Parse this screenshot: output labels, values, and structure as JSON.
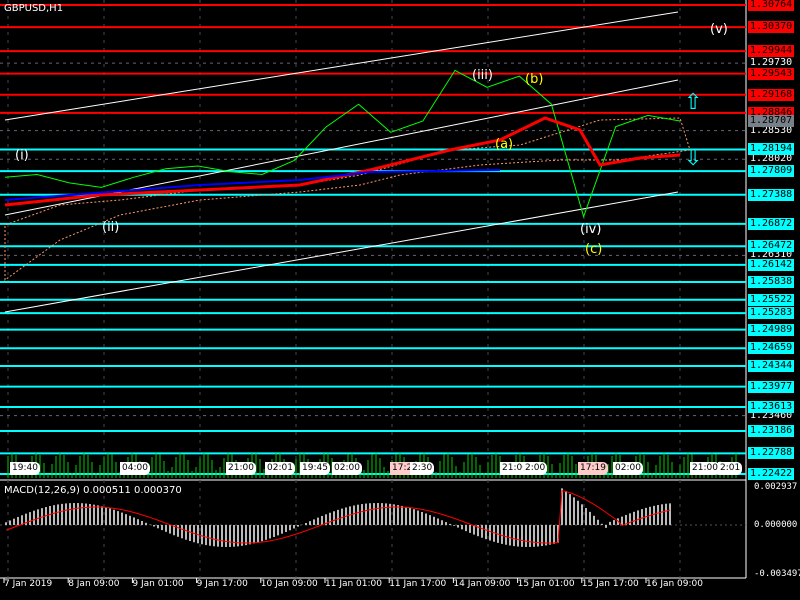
{
  "symbol_label": "GBPUSD,H1",
  "macd_label": "MACD(12,26,9) 0.000511 0.000370",
  "price_scale": {
    "max": 1.30764,
    "min": 1.22422
  },
  "red_levels": [
    "1.30764",
    "1.30370",
    "1.29944",
    "1.29543",
    "1.29168",
    "1.28846"
  ],
  "cyan_levels": [
    "1.28194",
    "1.27809",
    "1.27388",
    "1.26872",
    "1.26472",
    "1.26142",
    "1.25838",
    "1.25522",
    "1.25283",
    "1.24989",
    "1.24659",
    "1.24344",
    "1.23977",
    "1.23613",
    "1.23186",
    "1.22788",
    "1.22422"
  ],
  "white_levels": [
    "1.29730",
    "1.28530",
    "1.28020",
    "1.26310",
    "1.23460"
  ],
  "current_price": "1.28707",
  "macd_scale": {
    "max": "0.002937",
    "zero": "0.000000",
    "min": "-0.003497"
  },
  "time_labels": [
    "7 Jan 2019",
    "8 Jan 09:00",
    "9 Jan 01:00",
    "9 Jan 17:00",
    "10 Jan 09:00",
    "11 Jan 01:00",
    "11 Jan 17:00",
    "14 Jan 09:00",
    "15 Jan 01:00",
    "15 Jan 17:00",
    "16 Jan 09:00"
  ],
  "volume_tags": [
    "19:40",
    "04:00",
    "21:00",
    "02:01",
    "19:45",
    "02:00",
    "17:23",
    "2:30",
    "21:00",
    "2:00",
    "17:19",
    "02:00",
    "21:00",
    "2:01"
  ],
  "waves": [
    {
      "t": "(i)",
      "c": "#ffffff"
    },
    {
      "t": "(ii)",
      "c": "#ffffff"
    },
    {
      "t": "(iii)",
      "c": "#ffffff"
    },
    {
      "t": "(iv)",
      "c": "#ffffff"
    },
    {
      "t": "(v)",
      "c": "#ffffff"
    },
    {
      "t": "(a)",
      "c": "#ffff00"
    },
    {
      "t": "(b)",
      "c": "#ffff00"
    },
    {
      "t": "(c)",
      "c": "#ffff00"
    }
  ],
  "colors": {
    "red_level": "#ff0000",
    "cyan_level": "#00ffff",
    "price_line": "#00ff00",
    "ma": "#ff0000"
  },
  "chart_data": {
    "type": "line",
    "title": "GBPUSD,H1",
    "approx_price": [
      1.277,
      1.2775,
      1.276,
      1.2752,
      1.277,
      1.2785,
      1.279,
      1.278,
      1.2775,
      1.28,
      1.286,
      1.29,
      1.285,
      1.287,
      1.296,
      1.293,
      1.295,
      1.29,
      1.27,
      1.286,
      1.288,
      1.287
    ]
  }
}
